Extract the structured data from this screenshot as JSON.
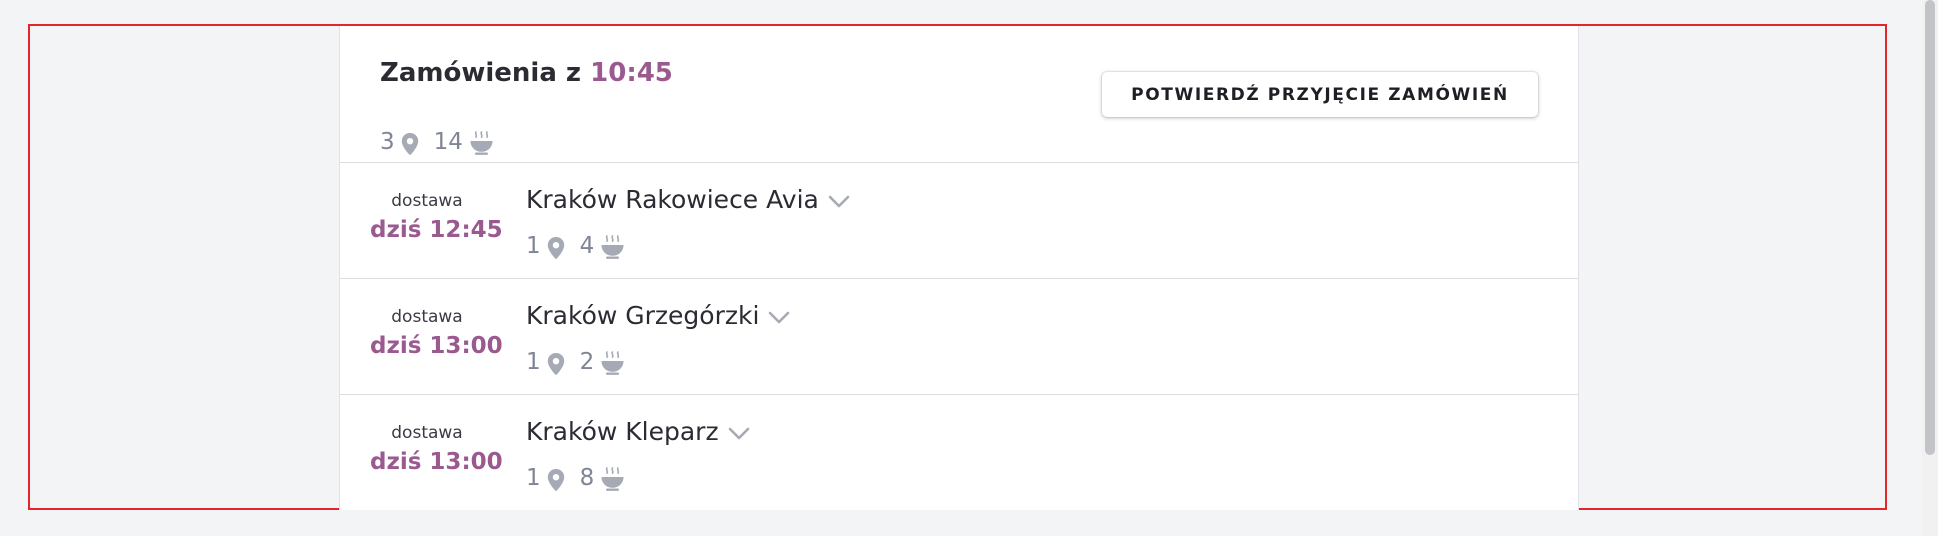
{
  "header": {
    "title_prefix": "Zamówienia z",
    "title_time": "10:45",
    "locations_count": "3",
    "meals_count": "14",
    "confirm_label": "POTWIERDŹ PRZYJĘCIE ZAMÓWIEŃ"
  },
  "orders": [
    {
      "label": "dostawa",
      "time": "dziś 12:45",
      "location": "Kraków Rakowiece Avia",
      "locations_count": "1",
      "meals_count": "4"
    },
    {
      "label": "dostawa",
      "time": "dziś 13:00",
      "location": "Kraków Grzegórzki",
      "locations_count": "1",
      "meals_count": "2"
    },
    {
      "label": "dostawa",
      "time": "dziś 13:00",
      "location": "Kraków Kleparz",
      "locations_count": "1",
      "meals_count": "8"
    }
  ],
  "icons": {
    "location": "map-pin-icon",
    "meal": "soup-bowl-icon",
    "expand": "chevron-down-icon"
  },
  "colors": {
    "accent": "#9a5a90",
    "icon": "#a5aab5",
    "highlight_border": "#e3262c"
  }
}
